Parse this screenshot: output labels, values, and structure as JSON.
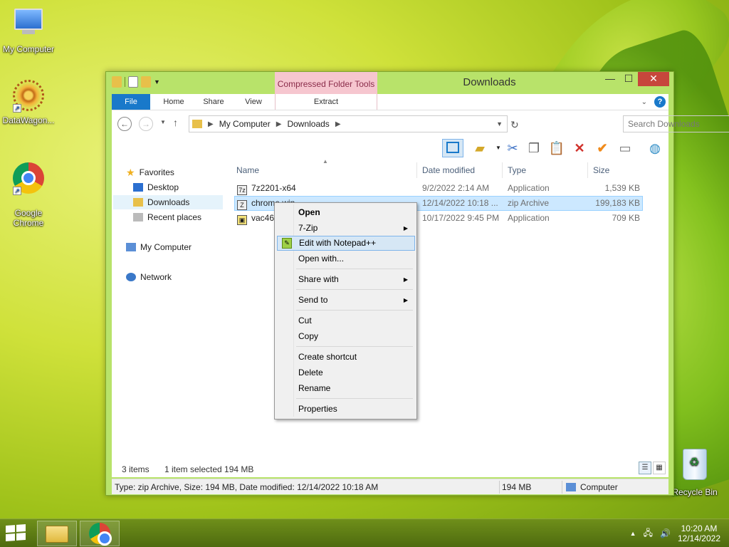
{
  "desktop": {
    "icons": [
      {
        "label": "My Computer"
      },
      {
        "label": "DataWagon..."
      },
      {
        "label": "Google\nChrome"
      },
      {
        "label": "Recycle Bin"
      }
    ]
  },
  "window": {
    "title": "Downloads",
    "contextual_tab_header": "Compressed Folder Tools",
    "tabs": {
      "file": "File",
      "home": "Home",
      "share": "Share",
      "view": "View",
      "extract": "Extract"
    },
    "address": {
      "segments": [
        "My Computer",
        "Downloads"
      ]
    },
    "search_placeholder": "Search Downloads"
  },
  "nav": {
    "favorites": "Favorites",
    "desktop": "Desktop",
    "downloads": "Downloads",
    "recent": "Recent places",
    "computer": "My Computer",
    "network": "Network"
  },
  "columns": {
    "name": "Name",
    "date": "Date modified",
    "type": "Type",
    "size": "Size"
  },
  "files": [
    {
      "name": "7z2201-x64",
      "date": "9/2/2022 2:14 AM",
      "type": "Application",
      "size": "1,539 KB"
    },
    {
      "name": "chrome.win",
      "date": "12/14/2022 10:18 ...",
      "type": "zip Archive",
      "size": "199,183 KB"
    },
    {
      "name": "vac46",
      "date": "10/17/2022 9:45 PM",
      "type": "Application",
      "size": "709 KB"
    }
  ],
  "status": {
    "items": "3 items",
    "selected": "1 item selected  194 MB"
  },
  "details": {
    "text": "Type: zip Archive, Size: 194 MB, Date modified: 12/14/2022 10:18 AM",
    "size": "194 MB",
    "location": "Computer"
  },
  "context_menu": {
    "open": "Open",
    "zip7": "7-Zip",
    "notepad": "Edit with Notepad++",
    "open_with": "Open with...",
    "share_with": "Share with",
    "send_to": "Send to",
    "cut": "Cut",
    "copy": "Copy",
    "create_shortcut": "Create shortcut",
    "delete": "Delete",
    "rename": "Rename",
    "properties": "Properties"
  },
  "taskbar": {
    "time": "10:20 AM",
    "date": "12/14/2022"
  },
  "colors": {
    "accent": "#1979ca",
    "selection": "#cce8ff",
    "close": "#c7463c"
  }
}
